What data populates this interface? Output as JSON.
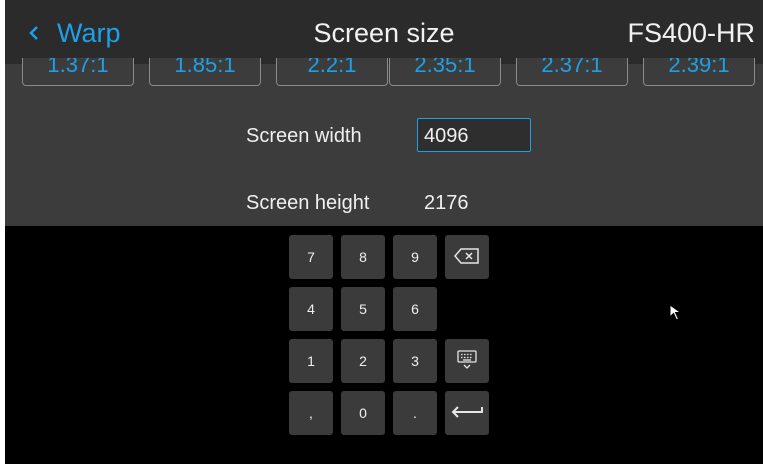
{
  "header": {
    "back_label": "Warp",
    "title": "Screen size",
    "model": "FS400-HR"
  },
  "aspect_ratios": [
    "1.37:1",
    "1.85:1",
    "2.2:1",
    "2.35:1",
    "2.37:1",
    "2.39:1"
  ],
  "fields": {
    "width_label": "Screen width",
    "width_value": "4096",
    "height_label": "Screen height",
    "height_value": "2176"
  },
  "keypad": {
    "keys": [
      "7",
      "8",
      "9",
      "4",
      "5",
      "6",
      "1",
      "2",
      "3",
      ",",
      "0",
      "."
    ]
  },
  "colors": {
    "accent": "#1ea0e6",
    "header_bg": "#2b2b2b",
    "panel_bg": "#3c3c3c",
    "key_bg": "#3b3b3b"
  }
}
